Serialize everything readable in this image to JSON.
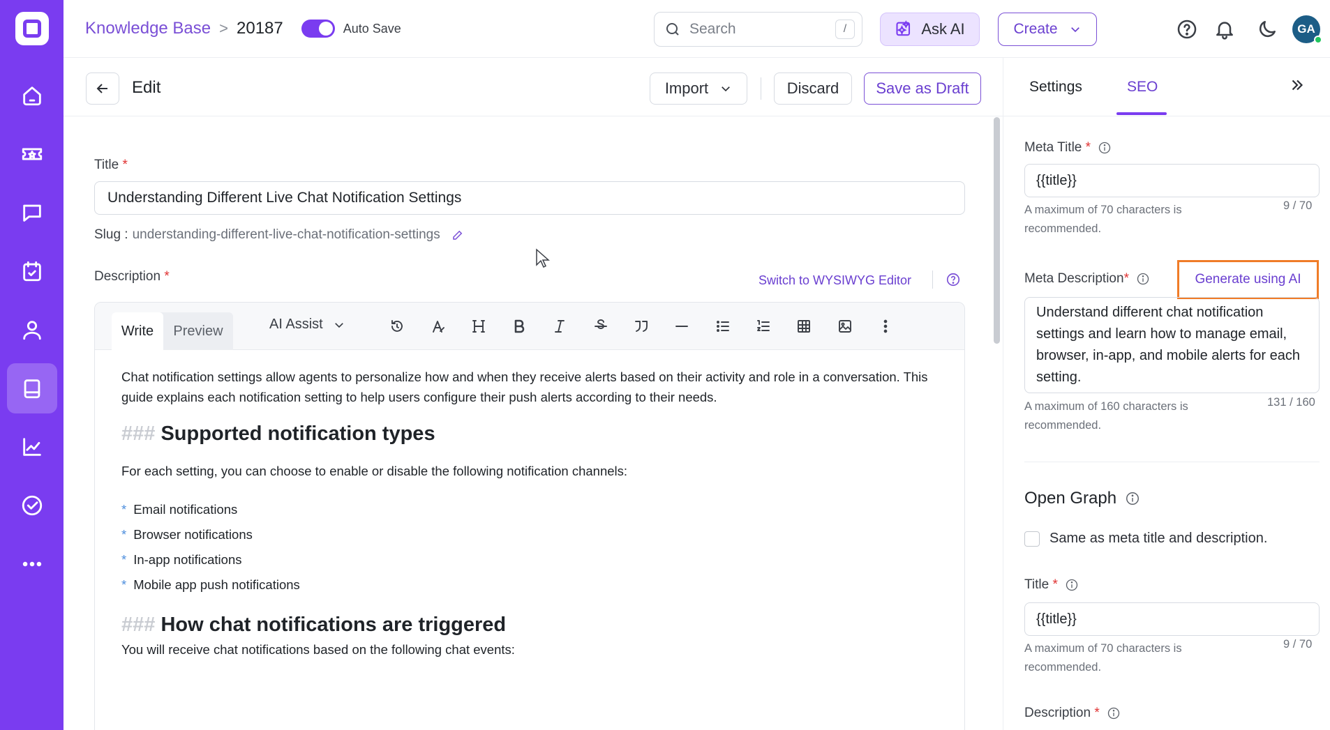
{
  "sidebar": {
    "items": [
      {
        "icon": "home-icon"
      },
      {
        "icon": "ticket-icon"
      },
      {
        "icon": "chat-icon"
      },
      {
        "icon": "calendar-check-icon"
      },
      {
        "icon": "user-icon"
      },
      {
        "icon": "knowledge-base-icon",
        "active": true
      },
      {
        "icon": "analytics-icon"
      },
      {
        "icon": "check-circle-icon"
      },
      {
        "icon": "more-icon"
      }
    ]
  },
  "header": {
    "breadcrumb_root": "Knowledge Base",
    "breadcrumb_sep": ">",
    "breadcrumb_id": "20187",
    "autosave_label": "Auto Save",
    "autosave_on": true,
    "search_placeholder": "Search",
    "search_shortcut": "/",
    "ask_ai_label": "Ask AI",
    "create_label": "Create",
    "avatar_initials": "GA"
  },
  "editor_header": {
    "title": "Edit",
    "import_label": "Import",
    "discard_label": "Discard",
    "save_draft_label": "Save as Draft"
  },
  "form": {
    "title_label": "Title",
    "required_mark": "*",
    "title_value": "Understanding Different Live Chat Notification Settings",
    "slug_label": "Slug :",
    "slug_value": "understanding-different-live-chat-notification-settings",
    "description_label": "Description",
    "switch_editor_label": "Switch to WYSIWYG Editor"
  },
  "markdown_toolbar": {
    "write_tab": "Write",
    "preview_tab": "Preview",
    "ai_assist_label": "AI Assist",
    "tools": [
      "undo-icon",
      "text-format-icon",
      "heading-icon",
      "bold-icon",
      "italic-icon",
      "strikethrough-icon",
      "quote-icon",
      "horizontal-rule-icon",
      "bullet-list-icon",
      "numbered-list-icon",
      "table-icon",
      "image-icon",
      "more-vertical-icon"
    ]
  },
  "content": {
    "intro": "Chat notification settings allow agents to personalize how and when they receive alerts based on their activity and role in a conversation. This guide explains each notification setting to help users configure their push alerts according to their needs.",
    "heading1_hash": "###",
    "heading1": "Supported notification types",
    "para2": "For each setting, you can choose to enable or disable the following notification channels:",
    "bullet_mark": "*",
    "bullets": [
      "Email notifications",
      "Browser notifications",
      "In-app notifications",
      "Mobile app push notifications"
    ],
    "heading2_hash": "###",
    "heading2": "How chat notifications are triggered",
    "para3": "You will receive chat notifications based on the following chat events:"
  },
  "right_panel": {
    "tab_settings": "Settings",
    "tab_seo": "SEO",
    "meta_title_label": "Meta Title",
    "meta_title_value": "{{title}}",
    "meta_title_hint": "A maximum of 70 characters is recommended.",
    "meta_title_count": "9 / 70",
    "meta_desc_label": "Meta Description",
    "generate_ai_label": "Generate using AI",
    "meta_desc_value": "Understand different chat notification settings and learn how to manage email, browser, in-app, and mobile alerts for each setting.",
    "meta_desc_hint": "A maximum of 160 characters is recommended.",
    "meta_desc_count": "131 / 160",
    "og_title": "Open Graph",
    "same_as_meta_label": "Same as meta title and description.",
    "og_title_label": "Title",
    "og_title_value": "{{title}}",
    "og_title_hint": "A maximum of 70 characters is recommended.",
    "og_title_count": "9 / 70",
    "og_desc_label": "Description"
  },
  "colors": {
    "brand": "#7a3cf0",
    "link": "#6a3fd0",
    "highlight": "#f07c28",
    "required": "#e03131"
  }
}
